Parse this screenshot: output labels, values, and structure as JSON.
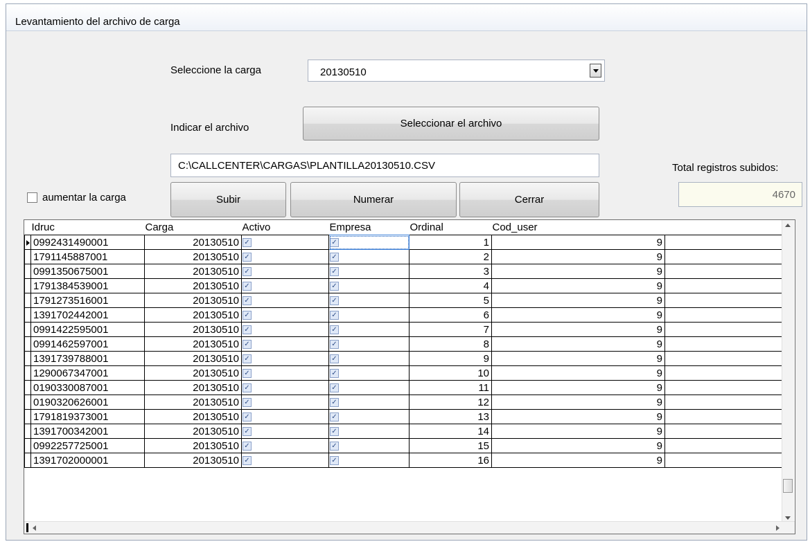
{
  "window": {
    "title": "Levantamiento del archivo de carga"
  },
  "form": {
    "carga_label": "Seleccione la carga",
    "carga_value": "20130510",
    "archivo_label": "Indicar el archivo",
    "select_file_button": "Seleccionar el archivo",
    "file_path": "C:\\CALLCENTER\\CARGAS\\PLANTILLA20130510.CSV",
    "total_label": "Total registros subidos:",
    "total_value": "4670",
    "aumentar_label": "aumentar la carga",
    "aumentar_checked": false,
    "buttons": {
      "subir": "Subir",
      "numerar": "Numerar",
      "cerrar": "Cerrar"
    }
  },
  "grid": {
    "columns": [
      "Idruc",
      "Carga",
      "Activo",
      "Empresa",
      "Ordinal",
      "Cod_user"
    ],
    "rows": [
      {
        "idruc": "0992431490001",
        "carga": "20130510",
        "activo": true,
        "empresa": true,
        "ordinal": "1",
        "cod_user": "9"
      },
      {
        "idruc": "1791145887001",
        "carga": "20130510",
        "activo": true,
        "empresa": true,
        "ordinal": "2",
        "cod_user": "9"
      },
      {
        "idruc": "0991350675001",
        "carga": "20130510",
        "activo": true,
        "empresa": true,
        "ordinal": "3",
        "cod_user": "9"
      },
      {
        "idruc": "1791384539001",
        "carga": "20130510",
        "activo": true,
        "empresa": true,
        "ordinal": "4",
        "cod_user": "9"
      },
      {
        "idruc": "1791273516001",
        "carga": "20130510",
        "activo": true,
        "empresa": true,
        "ordinal": "5",
        "cod_user": "9"
      },
      {
        "idruc": "1391702442001",
        "carga": "20130510",
        "activo": true,
        "empresa": true,
        "ordinal": "6",
        "cod_user": "9"
      },
      {
        "idruc": "0991422595001",
        "carga": "20130510",
        "activo": true,
        "empresa": true,
        "ordinal": "7",
        "cod_user": "9"
      },
      {
        "idruc": "0991462597001",
        "carga": "20130510",
        "activo": true,
        "empresa": true,
        "ordinal": "8",
        "cod_user": "9"
      },
      {
        "idruc": "1391739788001",
        "carga": "20130510",
        "activo": true,
        "empresa": true,
        "ordinal": "9",
        "cod_user": "9"
      },
      {
        "idruc": "1290067347001",
        "carga": "20130510",
        "activo": true,
        "empresa": true,
        "ordinal": "10",
        "cod_user": "9"
      },
      {
        "idruc": "0190330087001",
        "carga": "20130510",
        "activo": true,
        "empresa": true,
        "ordinal": "11",
        "cod_user": "9"
      },
      {
        "idruc": "0190320626001",
        "carga": "20130510",
        "activo": true,
        "empresa": true,
        "ordinal": "12",
        "cod_user": "9"
      },
      {
        "idruc": "1791819373001",
        "carga": "20130510",
        "activo": true,
        "empresa": true,
        "ordinal": "13",
        "cod_user": "9"
      },
      {
        "idruc": "1391700342001",
        "carga": "20130510",
        "activo": true,
        "empresa": true,
        "ordinal": "14",
        "cod_user": "9"
      },
      {
        "idruc": "0992257725001",
        "carga": "20130510",
        "activo": true,
        "empresa": true,
        "ordinal": "15",
        "cod_user": "9"
      },
      {
        "idruc": "1391702000001",
        "carga": "20130510",
        "activo": true,
        "empresa": true,
        "ordinal": "16",
        "cod_user": "9"
      }
    ]
  },
  "icons": {
    "dropdown": "chevron-down-icon",
    "row_pointer": "row-pointer-icon",
    "checkbox": "checkbox-checked-icon"
  }
}
